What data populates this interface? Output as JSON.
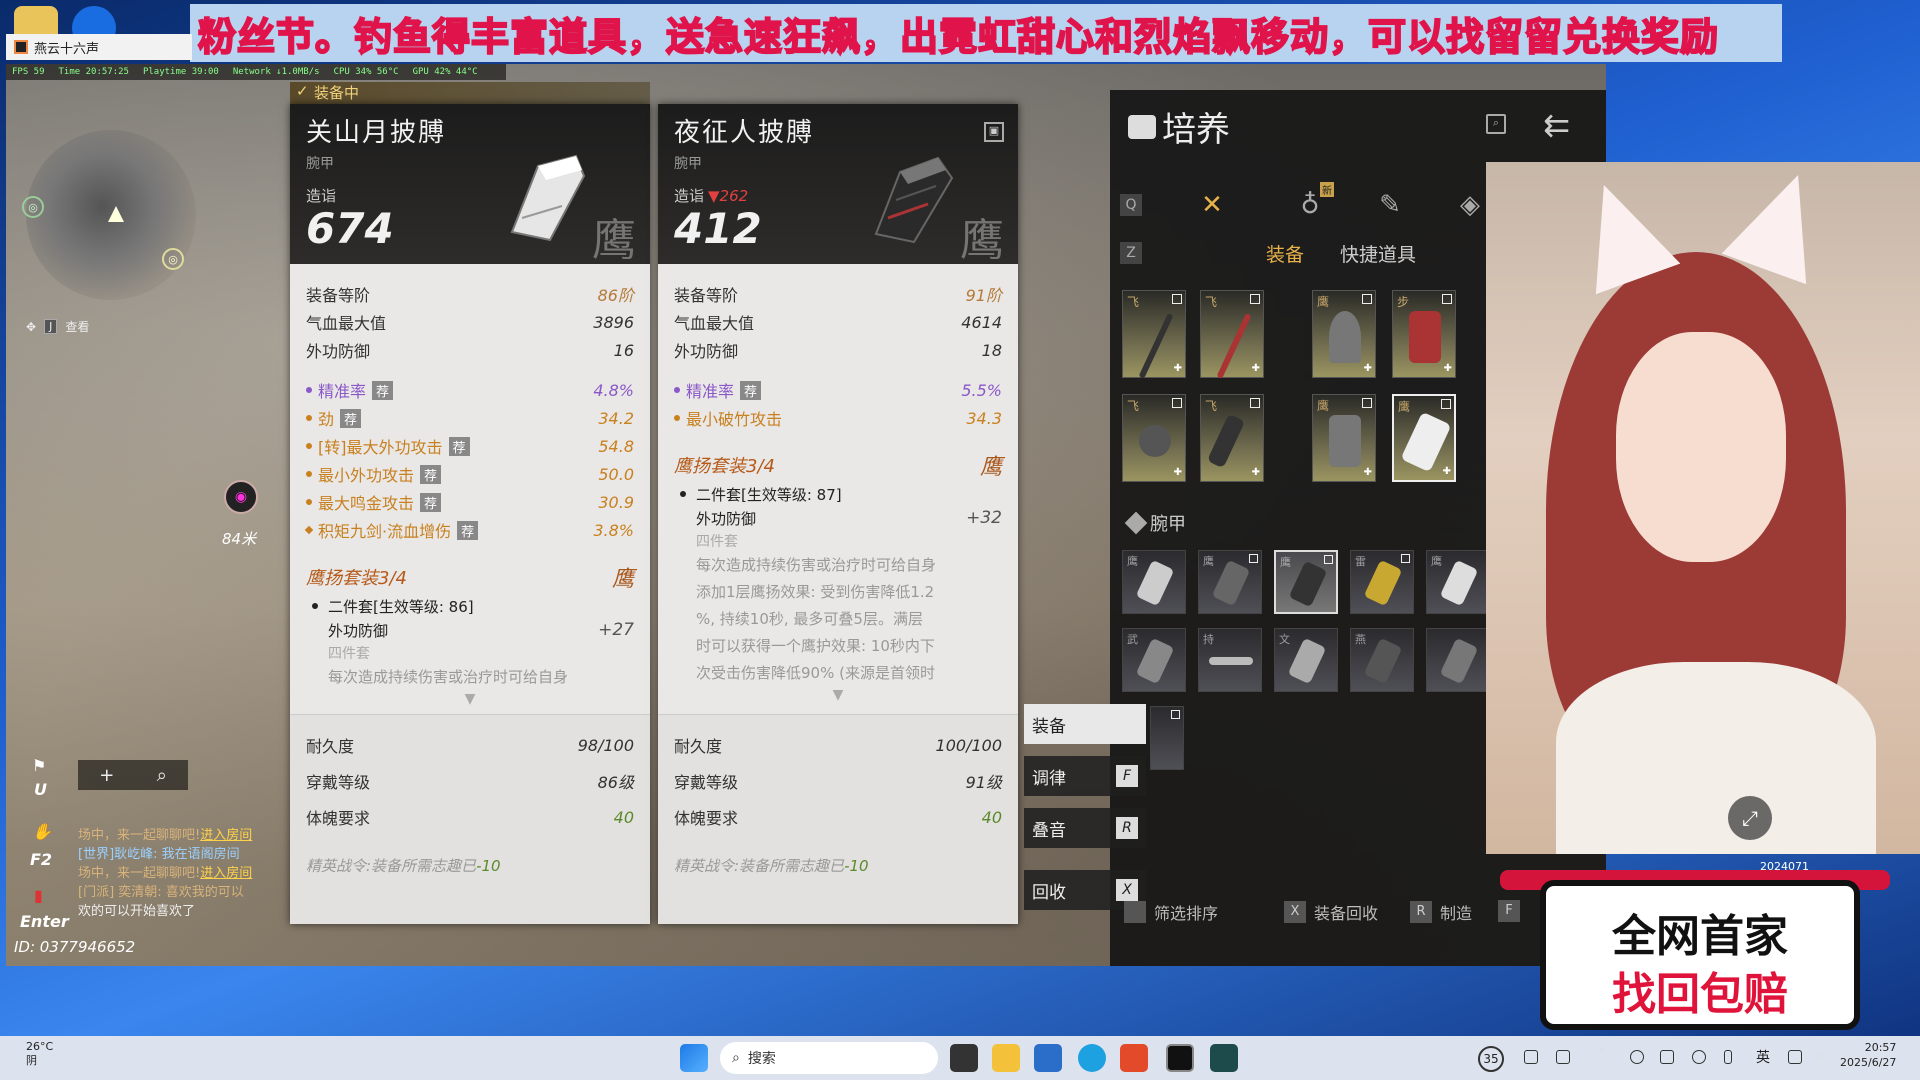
{
  "banner": {
    "text": "粉丝节。钓鱼得丰富道具，送急速狂飙，出霓虹甜心和烈焰飘移动，可以找留留兑换奖励"
  },
  "window": {
    "title": "燕云十六声"
  },
  "fps": {
    "fps": "FPS 59",
    "time": "Time 20:57:25",
    "playtime": "Playtime 39:00",
    "network": "Network ↓1.0MB/s",
    "cpu": "CPU 34% 56°C",
    "gpu": "GPU 42% 44°C"
  },
  "hud": {
    "look_key": "J",
    "look_label": "查看",
    "distance": "84米",
    "key_u": "U",
    "key_f2": "F2",
    "key_enter": "Enter",
    "user_id": "ID: 0377946652"
  },
  "chat": [
    {
      "channel": "场中，来一起聊聊吧!",
      "link": "进入房间"
    },
    {
      "channel": "[世界]耿屹峰: 我在语阁房间"
    },
    {
      "channel": "场中，来一起聊聊吧!",
      "link": "进入房间"
    },
    {
      "channel": "[门派] 奕清朝: 喜欢我的可以"
    },
    {
      "channel": "欢的可以开始喜欢了"
    }
  ],
  "equipped_tag": "装备中",
  "left_panel": {
    "name": "关山月披膊",
    "slot": "腕甲",
    "gs_label": "造诣",
    "gs": "674",
    "crest": "鹰",
    "tier_label": "装备等阶",
    "tier": "86阶",
    "stats": [
      {
        "label": "气血最大值",
        "value": "3896"
      },
      {
        "label": "外功防御",
        "value": "16"
      }
    ],
    "subs": [
      {
        "label": "精准率",
        "tag": "荐",
        "value": "4.8%",
        "purple": true
      },
      {
        "label": "劲",
        "tag": "荐",
        "value": "34.2"
      },
      {
        "label": "[转]最大外功攻击",
        "tag": "荐",
        "value": "54.8"
      },
      {
        "label": "最小外功攻击",
        "tag": "荐",
        "value": "50.0"
      },
      {
        "label": "最大鸣金攻击",
        "tag": "荐",
        "value": "30.9"
      },
      {
        "label": "积矩九剑·流血增伤",
        "tag": "荐",
        "value": "3.8%"
      }
    ],
    "set_title": "鹰扬套装3/4",
    "set_crest": "鹰",
    "set_two": "二件套[生效等级: 86]",
    "set_two_stat": "外功防御",
    "set_two_bonus": "+27",
    "set_four": "四件套",
    "set_four_desc": "每次造成持续伤害或治疗时可给自身",
    "durability_label": "耐久度",
    "durability": "98/100",
    "wear_label": "穿戴等级",
    "wear": "86级",
    "phys_label": "体魄要求",
    "phys": "40",
    "command_text": "精英战令:装备所需志趣已",
    "command_value": "-10"
  },
  "right_panel": {
    "name": "夜征人披膊",
    "slot": "腕甲",
    "gs_label": "造诣",
    "gs": "412",
    "gs_delta": "▼262",
    "crest": "鹰",
    "tier_label": "装备等阶",
    "tier": "91阶",
    "stats": [
      {
        "label": "气血最大值",
        "value": "4614"
      },
      {
        "label": "外功防御",
        "value": "18"
      }
    ],
    "subs": [
      {
        "label": "精准率",
        "tag": "荐",
        "value": "5.5%",
        "purple": true
      },
      {
        "label": "最小破竹攻击",
        "tag": "",
        "value": "34.3"
      }
    ],
    "set_title": "鹰扬套装3/4",
    "set_crest": "鹰",
    "set_two": "二件套[生效等级: 87]",
    "set_two_stat": "外功防御",
    "set_two_bonus": "+32",
    "set_four": "四件套",
    "set_four_desc": [
      "每次造成持续伤害或治疗时可给自身",
      "添加1层鹰扬效果: 受到伤害降低1.2",
      "%, 持续10秒, 最多可叠5层。满层",
      "时可以获得一个鹰护效果: 10秒内下",
      "次受击伤害降低90% (来源是首领时"
    ],
    "durability_label": "耐久度",
    "durability": "100/100",
    "wear_label": "穿戴等级",
    "wear": "91级",
    "phys_label": "体魄要求",
    "phys": "40",
    "command_text": "精英战令:装备所需志趣已",
    "command_value": "-10"
  },
  "cultivate": {
    "title": "培养",
    "key_q": "Q",
    "key_z": "Z",
    "new_badge": "新",
    "tabs": [
      "装备",
      "快捷道具"
    ],
    "bracer_label": "腕甲",
    "grid_chars": [
      "飞",
      "飞",
      "鹰",
      "步",
      "飞",
      "飞",
      "鹰",
      "鹰"
    ],
    "bracer_chars": [
      "鹰",
      "鹰",
      "鹰",
      "雷",
      "鹰",
      "武",
      "持",
      "文",
      "燕",
      ""
    ]
  },
  "actions": [
    {
      "label": "装备",
      "key": ""
    },
    {
      "label": "调律",
      "key": "F"
    },
    {
      "label": "叠音",
      "key": "R"
    }
  ],
  "cancel_action": {
    "label": "回收",
    "key": "X"
  },
  "bottom_hints": [
    {
      "key": "",
      "label": "筛选排序"
    },
    {
      "key": "X",
      "label": "装备回收"
    },
    {
      "key": "R",
      "label": "制造"
    },
    {
      "key": "F",
      "label": ""
    }
  ],
  "promo": {
    "line1": "全网首家",
    "line2": "找回包赔"
  },
  "cam": {
    "date": "2024071"
  },
  "taskbar": {
    "search": "搜索",
    "weather_temp": "26°C",
    "weather_desc": "阴",
    "notif": "35",
    "ime": "英",
    "time": "20:57",
    "date": "2025/6/27"
  }
}
